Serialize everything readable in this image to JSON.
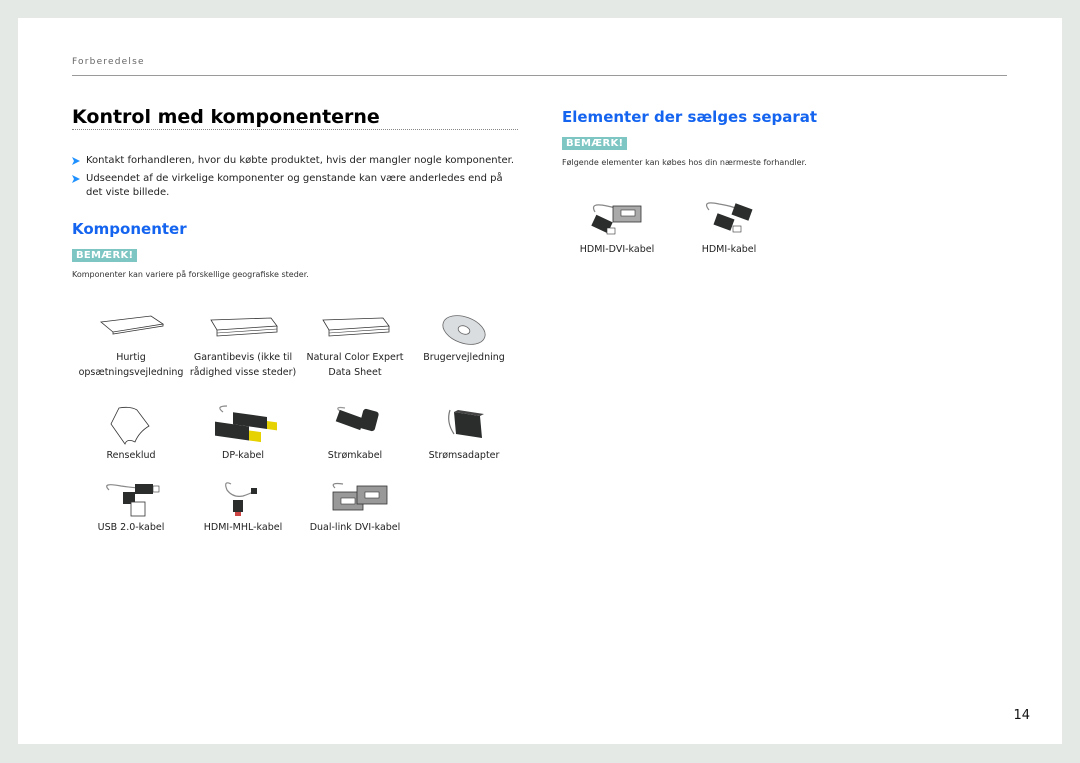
{
  "header": {
    "section": "Forberedelse"
  },
  "left": {
    "title": "Kontrol med komponenterne",
    "bullets": [
      "Kontakt forhandleren, hvor du købte produktet, hvis der mangler nogle komponenter.",
      "Udseendet af de virkelige komponenter og genstande kan være anderledes end på det viste billede."
    ],
    "subtitle": "Komponenter",
    "badge": "BEMÆRK!",
    "note": "Komponenter kan variere på forskellige geografiske steder.",
    "items": [
      {
        "label": "Hurtig opsætningsvejledning",
        "icon": "booklet-icon"
      },
      {
        "label": "Garantibevis (ikke til rådighed visse steder)",
        "icon": "warranty-card-icon"
      },
      {
        "label": "Natural Color Expert Data Sheet",
        "icon": "data-sheet-icon"
      },
      {
        "label": "Brugervejledning",
        "icon": "cd-icon"
      },
      {
        "label": "Renseklud",
        "icon": "cloth-icon"
      },
      {
        "label": "DP-kabel",
        "icon": "dp-cable-icon"
      },
      {
        "label": "Strømkabel",
        "icon": "power-cable-icon"
      },
      {
        "label": "Strømsadapter",
        "icon": "power-adapter-icon"
      },
      {
        "label": "USB 2.0-kabel",
        "icon": "usb-cable-icon"
      },
      {
        "label": "HDMI-MHL-kabel",
        "icon": "hdmi-mhl-cable-icon"
      },
      {
        "label": "Dual-link DVI-kabel",
        "icon": "dvi-cable-icon"
      }
    ]
  },
  "right": {
    "title": "Elementer der sælges separat",
    "badge": "BEMÆRK!",
    "note": "Følgende elementer kan købes hos din nærmeste forhandler.",
    "items": [
      {
        "label": "HDMI-DVI-kabel",
        "icon": "hdmi-dvi-cable-icon"
      },
      {
        "label": "HDMI-kabel",
        "icon": "hdmi-cable-icon"
      }
    ]
  },
  "footer": {
    "page_number": "14"
  },
  "colors": {
    "accent": "#1464f0",
    "badge": "#7dc6c3",
    "background": "#e4e9e6"
  }
}
